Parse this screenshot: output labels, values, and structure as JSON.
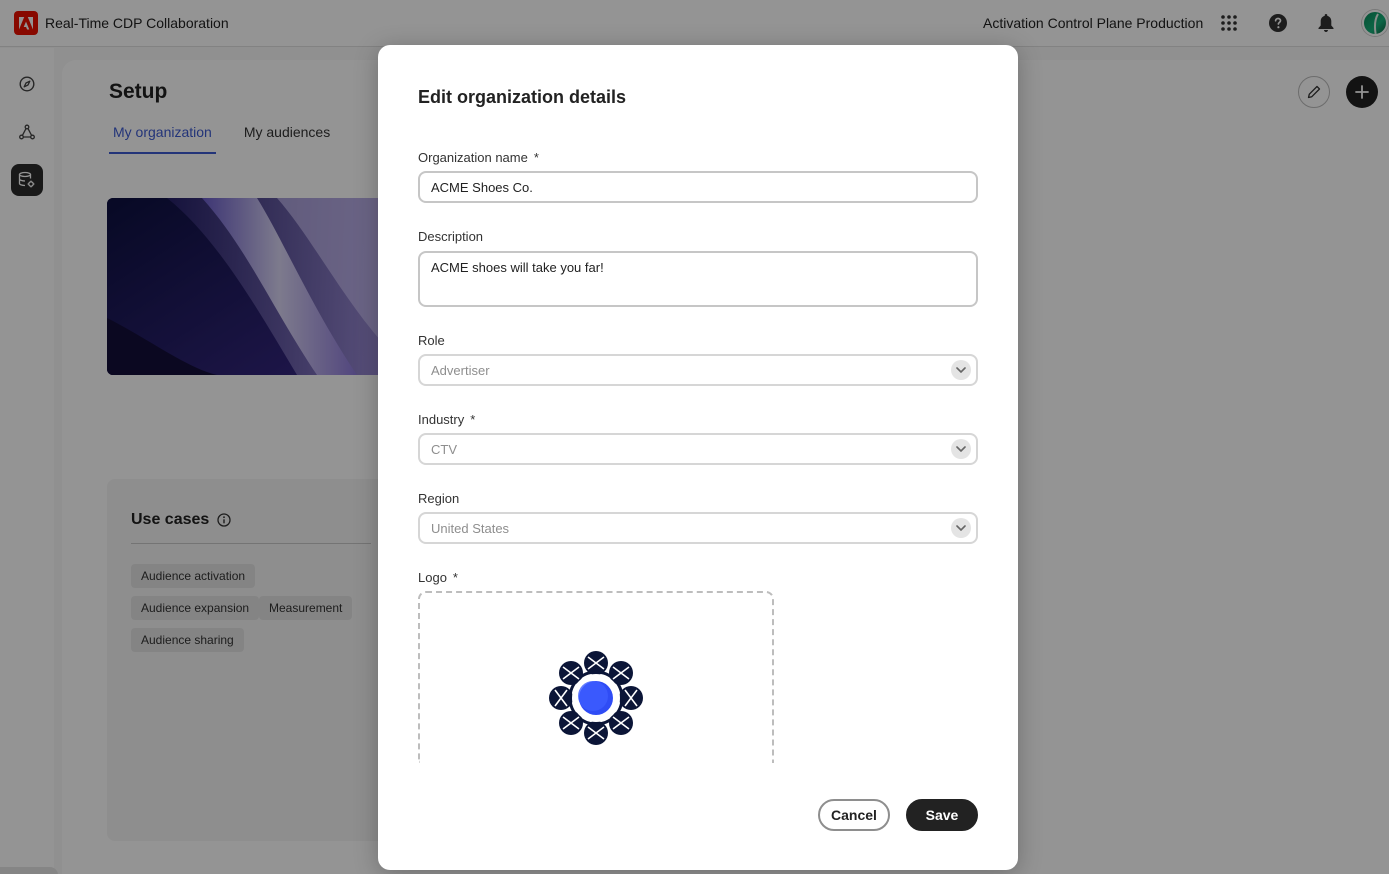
{
  "topbar": {
    "app_title": "Real-Time CDP Collaboration",
    "org_name": "Activation Control Plane Production",
    "icons": [
      "adobe-logo-icon",
      "apps-grid-icon",
      "help-icon",
      "bell-icon",
      "avatar"
    ]
  },
  "rail": {
    "items": [
      "compass-icon",
      "connections-icon",
      "data-setup-icon"
    ],
    "emojis": [
      "🎃",
      "😬"
    ]
  },
  "setup": {
    "title": "Setup",
    "tabs": [
      {
        "label": "My organization",
        "selected": true
      },
      {
        "label": "My audiences",
        "selected": false
      }
    ],
    "use_cases": {
      "title": "Use cases",
      "chips": [
        "Audience activation",
        "Audience expansion",
        "Measurement",
        "Audience sharing"
      ]
    }
  },
  "dialog": {
    "title": "Edit organization details",
    "fields": {
      "org_name": {
        "label": "Organization name",
        "required_mark": "*",
        "value": "ACME Shoes Co."
      },
      "description": {
        "label": "Description",
        "value": "ACME shoes will take you far!"
      },
      "role": {
        "label": "Role",
        "value": "Advertiser"
      },
      "industry": {
        "label": "Industry",
        "required_mark": "*",
        "value": "CTV"
      },
      "region": {
        "label": "Region",
        "value": "United States"
      },
      "logo": {
        "label": "Logo",
        "required_mark": "*"
      }
    },
    "buttons": {
      "cancel": "Cancel",
      "save": "Save"
    }
  },
  "colors": {
    "accent": "#3d5bd1",
    "adobe_red": "#eb1000",
    "save_button": "#222222",
    "logo_dark": "#0b1537",
    "logo_blue": "#2f4cf5"
  }
}
